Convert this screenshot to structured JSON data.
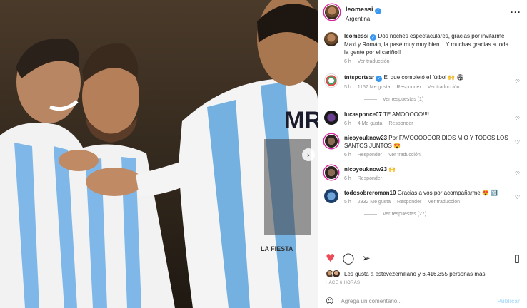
{
  "post": {
    "username": "leomessi",
    "location": "Argentina",
    "caption": "Dos noches espectaculares, gracias por invitarme Maxi y Román, la pasé muy muy bien... Y muchas gracias a toda la gente por el cariño!!",
    "caption_time": "6 h",
    "see_translation": "Ver traducción",
    "jersey_name": "MR",
    "jersey_caption": "LA FIESTA"
  },
  "comments": [
    {
      "username": "tntsportsar",
      "verified": true,
      "text": "El que completó el fútbol 🙌 🏟",
      "time": "5 h",
      "likes": "1157 Me gusta",
      "reply": "Responder",
      "translate": "Ver traducción",
      "view_replies": "Ver respuestas (1)"
    },
    {
      "username": "lucasponce07",
      "text": "TE AMOOOOO!!!!",
      "time": "6 h",
      "likes": "4 Me gusta",
      "reply": "Responder"
    },
    {
      "username": "nicoyouknow23",
      "text": "Por FAVOOOOOOR DIOS MIO Y TODOS LOS SANTOS JUNTOS 😍",
      "time": "6 h",
      "reply": "Responder",
      "translate": "Ver traducción"
    },
    {
      "username": "nicoyouknow23",
      "text": "🙌",
      "time": "6 h",
      "reply": "Responder"
    },
    {
      "username": "todosobreroman10",
      "text": "Gracias a vos por acompañarme 😍 🔟",
      "time": "5 h",
      "likes": "2932 Me gusta",
      "reply": "Responder",
      "translate": "Ver traducción",
      "view_replies": "Ver respuestas (27)"
    }
  ],
  "likes": {
    "text": "Les gusta a estevezemiliano y 6.416.355 personas más"
  },
  "time_ago": "HACE 6 HORAS",
  "add_comment": {
    "placeholder": "Agrega un comentario...",
    "publish": "Publicar"
  },
  "icons": [
    "heart-icon",
    "comment-icon",
    "share-icon",
    "bookmark-icon",
    "more-icon",
    "emoji-icon",
    "chevron-right-icon"
  ],
  "colors": {
    "like_red": "#ed4956",
    "verified_blue": "#3897f0",
    "meta_gray": "#8e8e8e"
  }
}
